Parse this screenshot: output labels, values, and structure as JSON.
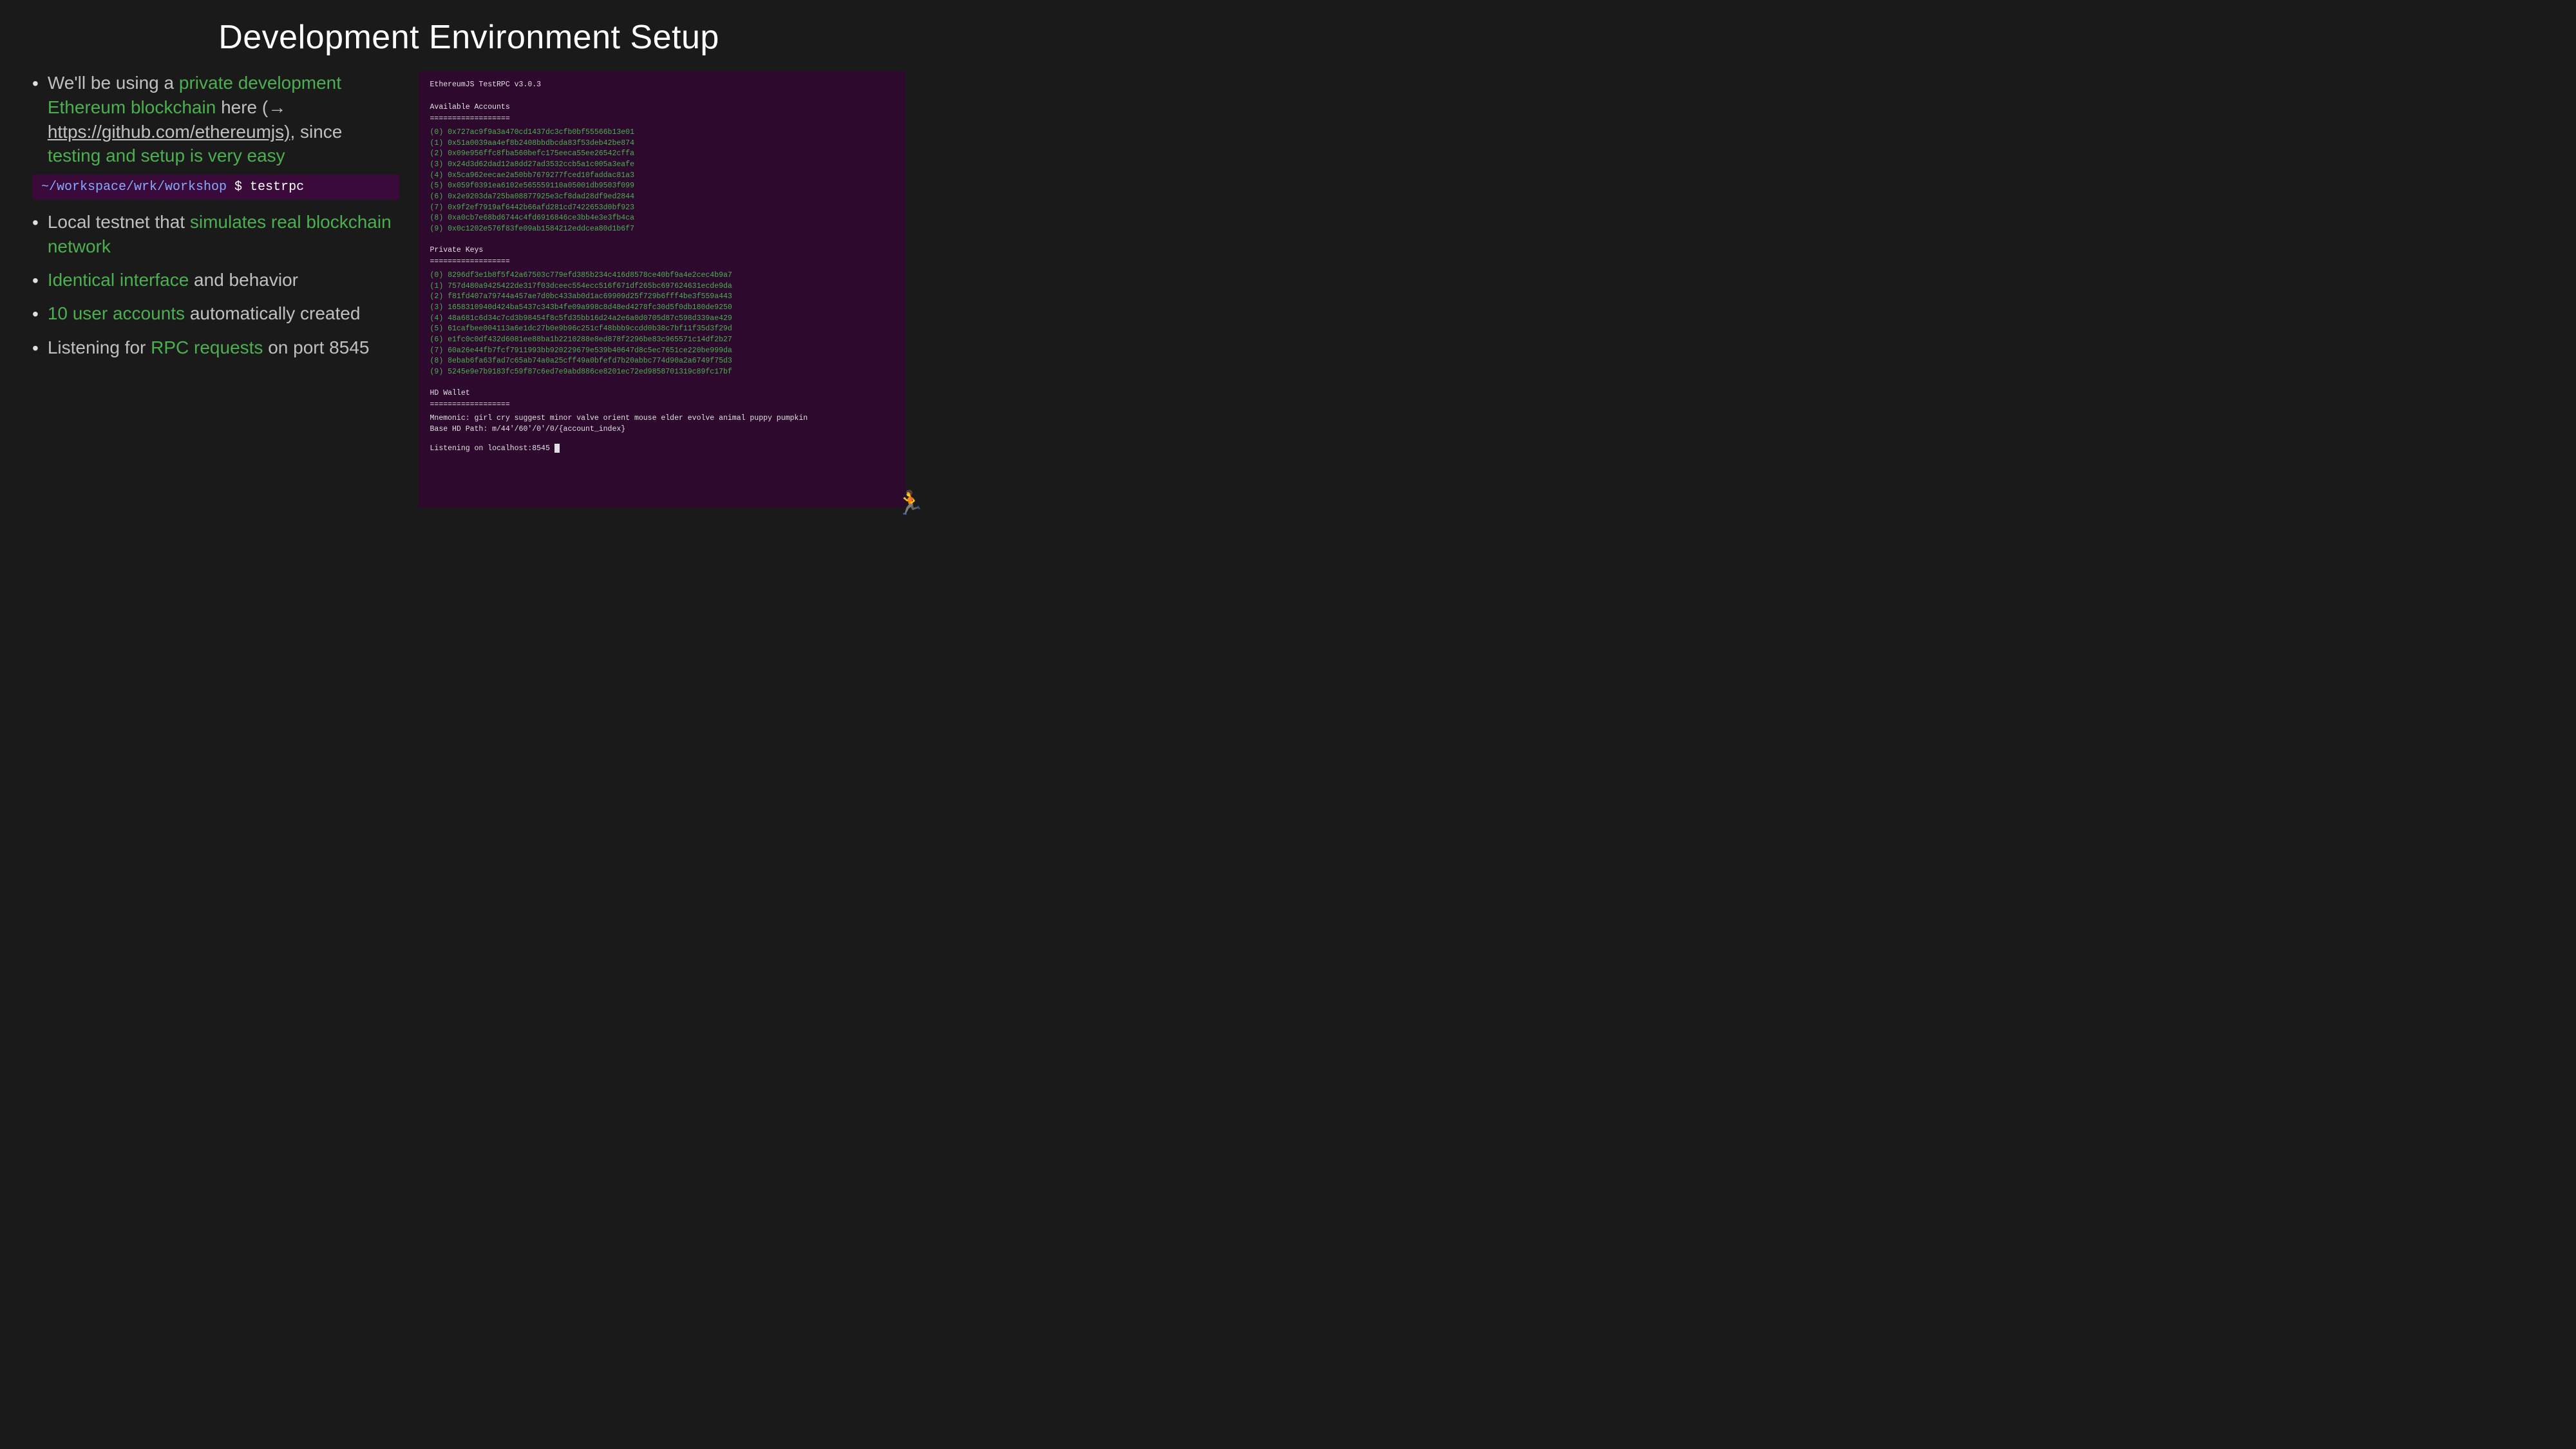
{
  "slide": {
    "title": "Development Environment Setup",
    "bullets": [
      {
        "id": "bullet1",
        "prefix": "We'll be using a ",
        "highlight1": "private development Ethereum blockchain",
        "middle1": " here (→ ",
        "link": "https://github.com/ethereumjs)",
        "suffix": ", since ",
        "highlight2": "testing and setup is very easy"
      },
      {
        "id": "bullet2",
        "prefix": "Local testnet that ",
        "highlight1": "simulates real blockchain network",
        "suffix": ""
      },
      {
        "id": "bullet3",
        "prefix": "",
        "highlight1": "Identical interface",
        "suffix": " and behavior"
      },
      {
        "id": "bullet4",
        "prefix": "",
        "highlight1": "10 user accounts",
        "suffix": " automatically created"
      },
      {
        "id": "bullet5",
        "prefix": "Listening for ",
        "highlight1": "RPC requests",
        "suffix": " on port 8545"
      }
    ],
    "terminal_command": {
      "prompt": "~/workspace/wrk/workshop",
      "command": "$ testrpc"
    },
    "rpc_output": {
      "header": "EthereumJS TestRPC v3.0.3",
      "accounts_label": "Available Accounts",
      "divider1": "==================",
      "accounts": [
        "(0) 0x727ac9f9a3a470cd1437dc3cfb0bf55566b13e01",
        "(1) 0x51a0039aa4ef8b2408bbdbcda83f53deb42be874",
        "(2) 0x09e956ffc8fba560befc175eeca55ee26542cffa",
        "(3) 0x24d3d62dad12a8dd27ad3532ccb5a1c005a3eafe",
        "(4) 0x5ca962eecae2a50bb7679277fced10faddac81a3",
        "(5) 0x059f0391ea6102e565559110a05001db9503f099",
        "(6) 0x2e9203da725ba08877925e3cf8dad28df9ed2844",
        "(7) 0x9f2ef7919af6442b66afd281cd7422653d0bf923",
        "(8) 0xa0cb7e68bd6744c4fd6916846ce3bb4e3e3fb4ca",
        "(9) 0x0c1202e576f83fe09ab1584212eddcea80d1b6f7"
      ],
      "private_keys_label": "Private Keys",
      "divider2": "==================",
      "private_keys": [
        "(0) 8296df3e1b8f5f42a67503c779efd385b234c416d8578ce40bf9a4e2cec4b9a7",
        "(1) 757d480a9425422de317f03dceec554ecc516f671df265bc697624631ecde9da",
        "(2) f81fd407a79744a457ae7d0bc433ab0d1ac69909d25f729b6fff4be3f559a443",
        "(3) 1658310940d424ba5437c343b4fe09a998c8d48ed4278fc30d5f0db180de9250",
        "(4) 48a681c6d34c7cd3b98454f8c5fd35bb16d24a2e6a0d0705d87c598d339ae429",
        "(5) 61cafbee004113a6e1dc27b0e9b96c251cf48bbb9ccdd0b38c7bf11f35d3f29d",
        "(6) e1fc0c0df432d6081ee88ba1b2210288e8ed878f2296be83c965571c14df2b27",
        "(7) 60a26e44fb7fcf7911993bb920229679e539b40647d8c5ec7651ce220be999da",
        "(8) 8ebab6fa63fad7c65ab74a0a25cff49a0bfefd7b20abbc774d90a2a6749f75d3",
        "(9) 5245e9e7b9183fc59f87c6ed7e9abd886ce8201ec72ed9858701319c89fc17bf"
      ],
      "hd_wallet_label": "HD Wallet",
      "divider3": "==================",
      "mnemonic_label": "Mnemonic:",
      "mnemonic_value": "girl cry suggest minor valve orient mouse elder evolve animal puppy pumpkin",
      "hd_path_label": "Base HD Path:",
      "hd_path_value": "m/44'/60'/0'/0/{account_index}",
      "listen_label": "Listening on localhost:8545"
    }
  }
}
